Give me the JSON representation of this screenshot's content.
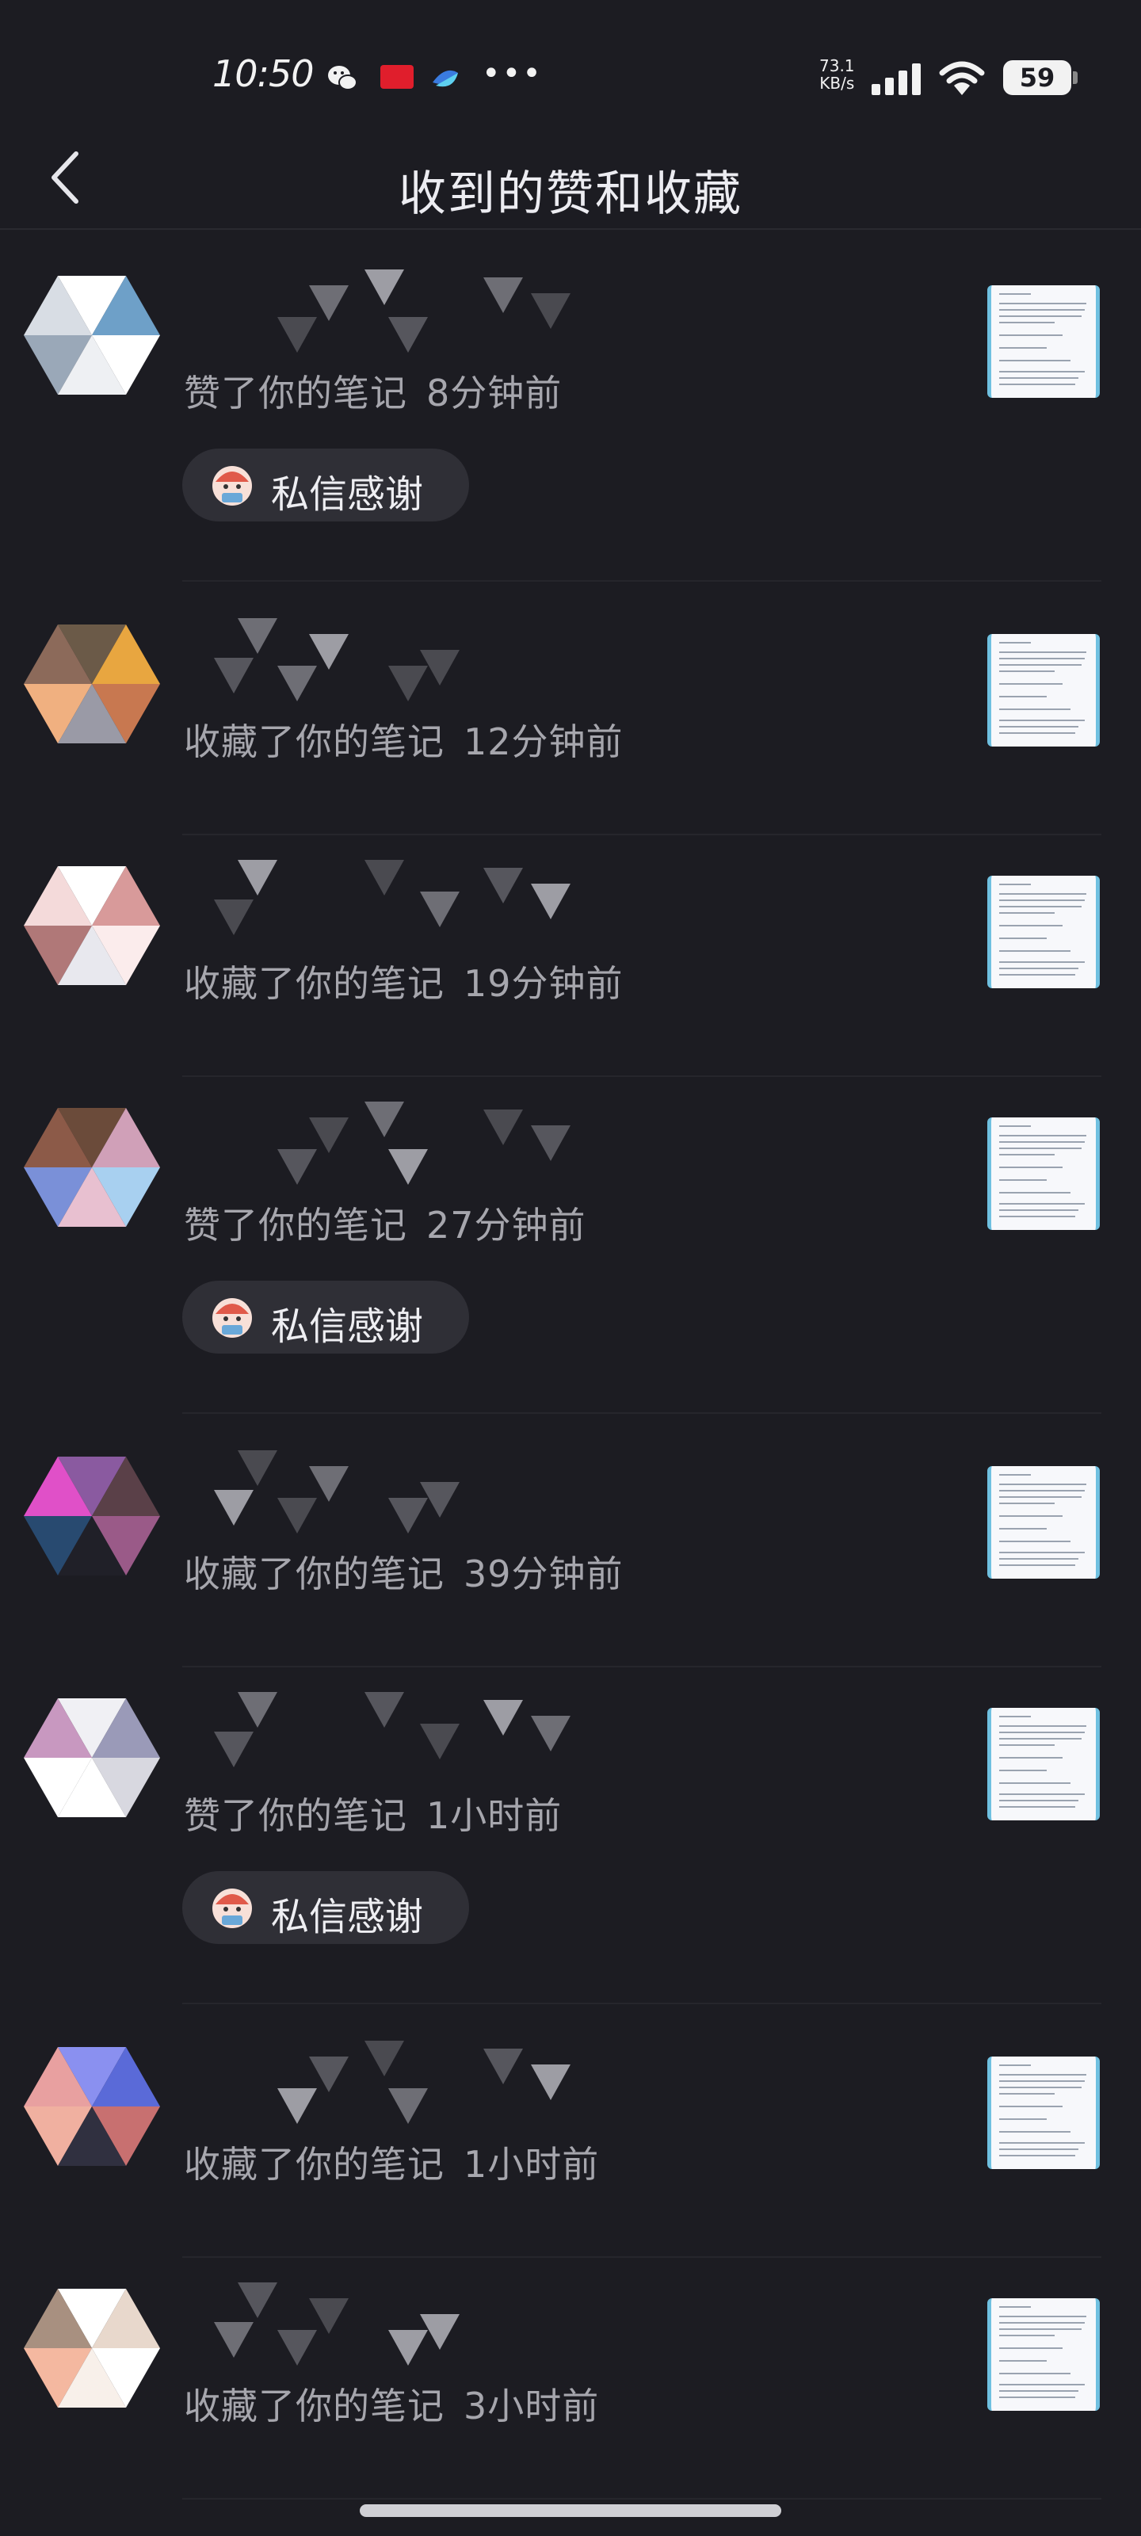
{
  "status_bar": {
    "time": "10:50",
    "net_speed_value": "73.1",
    "net_speed_unit": "KB/s",
    "battery": "59",
    "icons": [
      "wechat-icon",
      "notification-app-icon",
      "blue-app-icon",
      "more-dots-icon",
      "signal-icon",
      "wifi-icon",
      "battery-icon"
    ]
  },
  "header": {
    "title": "收到的赞和收藏",
    "back_icon": "chevron-left-icon"
  },
  "notifications": [
    {
      "action": "赞了你的笔记",
      "time": "8分钟前",
      "thank_button": true
    },
    {
      "action": "收藏了你的笔记",
      "time": "12分钟前",
      "thank_button": false
    },
    {
      "action": "收藏了你的笔记",
      "time": "19分钟前",
      "thank_button": false
    },
    {
      "action": "赞了你的笔记",
      "time": "27分钟前",
      "thank_button": true
    },
    {
      "action": "收藏了你的笔记",
      "time": "39分钟前",
      "thank_button": false
    },
    {
      "action": "赞了你的笔记",
      "time": "1小时前",
      "thank_button": true
    },
    {
      "action": "收藏了你的笔记",
      "time": "1小时前",
      "thank_button": false
    },
    {
      "action": "收藏了你的笔记",
      "time": "3小时前",
      "thank_button": false
    }
  ],
  "thank_button_label": "私信感谢",
  "colors": {
    "background": "#1c1c22",
    "secondary_text": "#a6a6ad",
    "button_bg": "#2f2f36",
    "thumbnail_accent": "#6fc0e0"
  }
}
